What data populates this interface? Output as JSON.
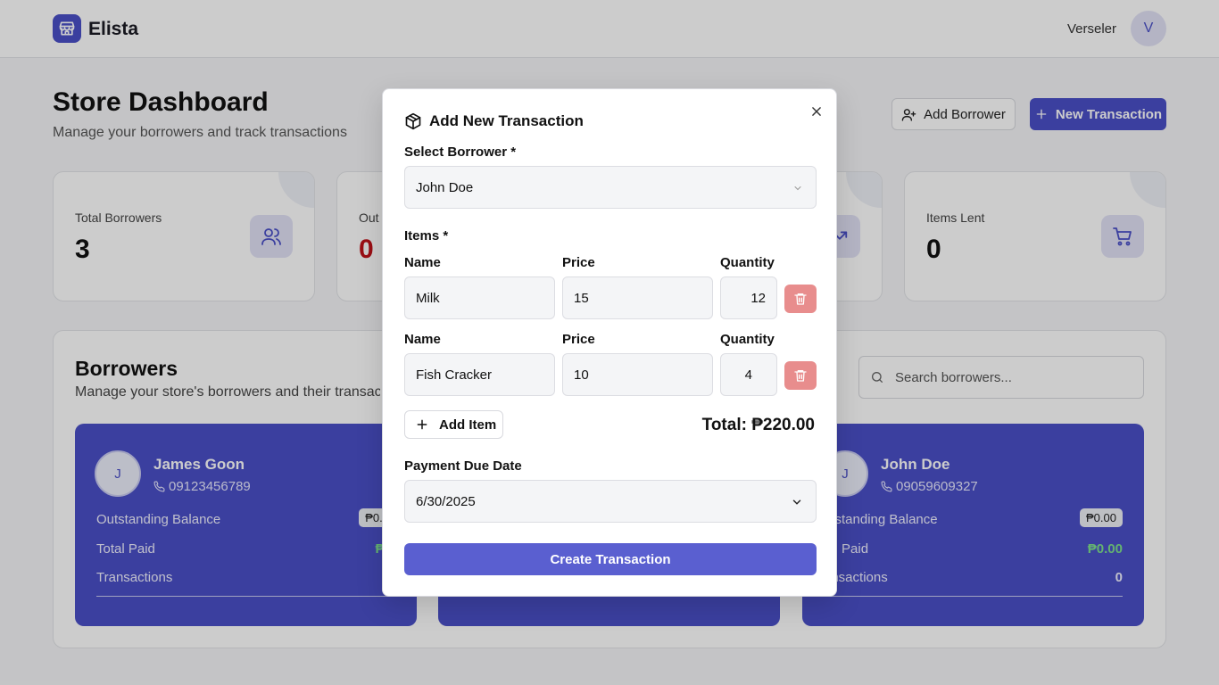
{
  "app": {
    "brand": "Elista",
    "user_name": "Verseler",
    "user_initial": "V"
  },
  "header": {
    "title": "Store Dashboard",
    "subtitle": "Manage your borrowers and track transactions",
    "add_borrower_label": "Add Borrower",
    "new_transaction_label": "New Transaction"
  },
  "stats": [
    {
      "label": "Total Borrowers",
      "value": "3"
    },
    {
      "label": "Out",
      "value": "0"
    },
    {
      "label": "Items Lent",
      "value": "0"
    }
  ],
  "borrowers": {
    "title": "Borrowers",
    "subtitle": "Manage your store's borrowers and their transac",
    "search_placeholder": "Search borrowers...",
    "cards": [
      {
        "initial": "J",
        "name": "James Goon",
        "phone": "09123456789",
        "outstanding_label": "Outstanding Balance",
        "outstanding": "₱0.0",
        "paid_label": "Total Paid",
        "paid": "₱0.",
        "transactions_label": "Transactions",
        "transactions": ""
      },
      {
        "initial": "J",
        "name": "John Doe",
        "phone": "09059609327",
        "outstanding_label": "utstanding Balance",
        "outstanding": "₱0.00",
        "paid_label": "tal Paid",
        "paid": "₱0.00",
        "transactions_label": "ansactions",
        "transactions": "0"
      }
    ]
  },
  "modal": {
    "title": "Add New Transaction",
    "borrower_label": "Select Borrower *",
    "borrower_value": "John Doe",
    "items_label": "Items *",
    "col_name": "Name",
    "col_price": "Price",
    "col_quantity": "Quantity",
    "items": [
      {
        "name": "Milk",
        "price": "15",
        "quantity": "12"
      },
      {
        "name": "Fish Cracker",
        "price": "10",
        "quantity": "4"
      }
    ],
    "add_item_label": "Add Item",
    "total_label": "Total: ₱220.00",
    "due_date_label": "Payment Due Date",
    "due_date_value": "6/30/2025",
    "create_label": "Create Transaction"
  },
  "colors": {
    "accent": "#4a4fc7",
    "danger": "#e88d8d",
    "positive": "#7ee08d",
    "outstanding": "#c0121a"
  }
}
